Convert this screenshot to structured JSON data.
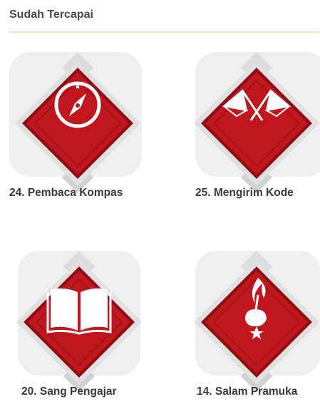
{
  "section": {
    "title": "Sudah Tercapai"
  },
  "colors": {
    "accent_divider": "#fbe0b8",
    "badge_red": "#c0161e",
    "badge_dark_red": "#8e0e14",
    "tile_bg": "#efefef"
  },
  "badges": [
    {
      "label": "24. Pembaca Kompas",
      "icon": "compass-icon"
    },
    {
      "label": "25. Mengirim Kode",
      "icon": "semaphore-flags-icon"
    },
    {
      "label": "20. Sang Pengajar",
      "icon": "open-book-icon"
    },
    {
      "label": "14. Salam Pramuka",
      "icon": "scout-emblem-icon"
    }
  ]
}
